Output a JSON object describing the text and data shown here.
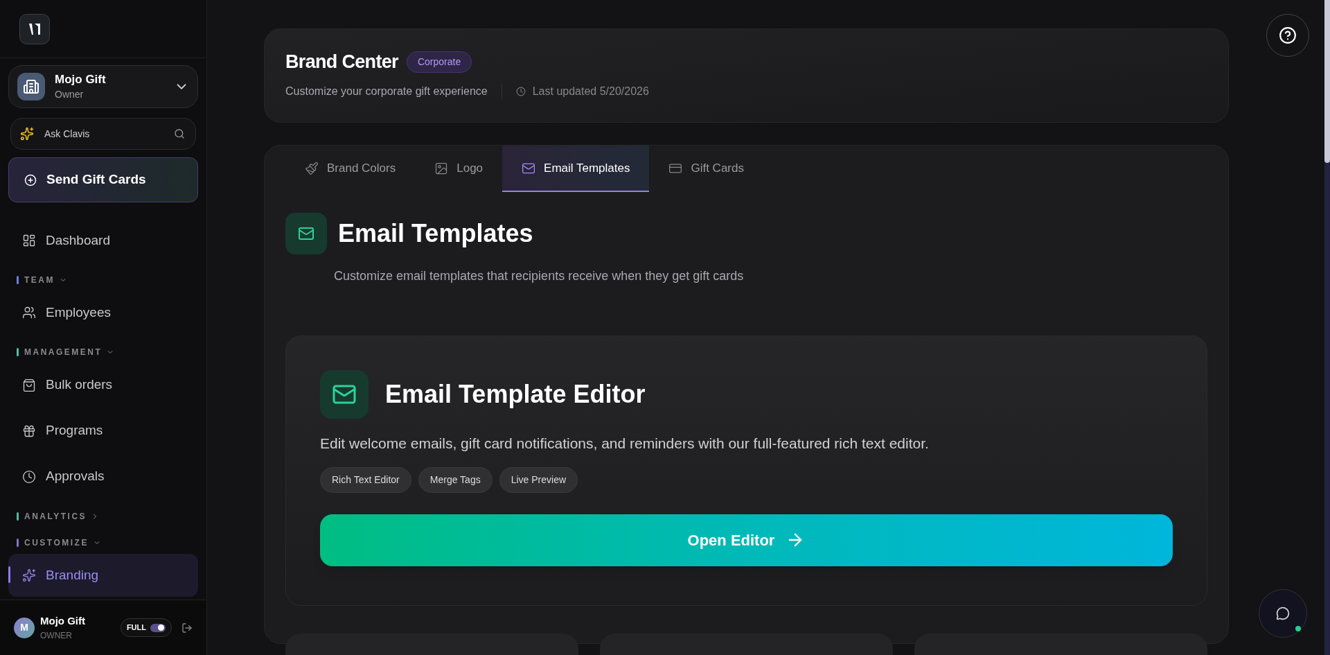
{
  "sidebar": {
    "org": {
      "name": "Mojo Gift",
      "role": "Owner"
    },
    "search": {
      "placeholder": "Ask Clavis"
    },
    "primary_button": "Send Gift Cards",
    "nav": [
      {
        "kind": "item",
        "label": "Dashboard",
        "selected": false
      },
      {
        "kind": "section",
        "label": "TEAM",
        "expanded": true,
        "color": "#6b7fe0"
      },
      {
        "kind": "item",
        "label": "Employees",
        "selected": false
      },
      {
        "kind": "section",
        "label": "MANAGEMENT",
        "expanded": true,
        "color": "#4fc0a8"
      },
      {
        "kind": "item",
        "label": "Bulk orders",
        "selected": false
      },
      {
        "kind": "item",
        "label": "Programs",
        "selected": false
      },
      {
        "kind": "item",
        "label": "Approvals",
        "selected": false
      },
      {
        "kind": "section",
        "label": "ANALYTICS",
        "expanded": false,
        "color": "#4fb8a0"
      },
      {
        "kind": "section",
        "label": "CUSTOMIZE",
        "expanded": true,
        "color": "#7f78c8"
      },
      {
        "kind": "item",
        "label": "Branding",
        "selected": true
      }
    ],
    "footer": {
      "avatar": "M",
      "name": "Mojo Gift",
      "role": "OWNER",
      "toggle_label": "FULL",
      "toggle_on": true
    }
  },
  "header": {
    "title": "Brand Center",
    "badge": "Corporate",
    "subtitle": "Customize your corporate gift experience",
    "last_updated": "Last updated 5/20/2026"
  },
  "tabs": [
    {
      "label": "Brand Colors",
      "selected": false
    },
    {
      "label": "Logo",
      "selected": false
    },
    {
      "label": "Email Templates",
      "selected": true
    },
    {
      "label": "Gift Cards",
      "selected": false
    }
  ],
  "section": {
    "title": "Email Templates",
    "description": "Customize email templates that recipients receive when they get gift cards"
  },
  "editor_card": {
    "title": "Email Template Editor",
    "description": "Edit welcome emails, gift card notifications, and reminders with our full-featured rich text editor.",
    "chips": [
      "Rich Text Editor",
      "Merge Tags",
      "Live Preview"
    ],
    "button": "Open Editor"
  }
}
